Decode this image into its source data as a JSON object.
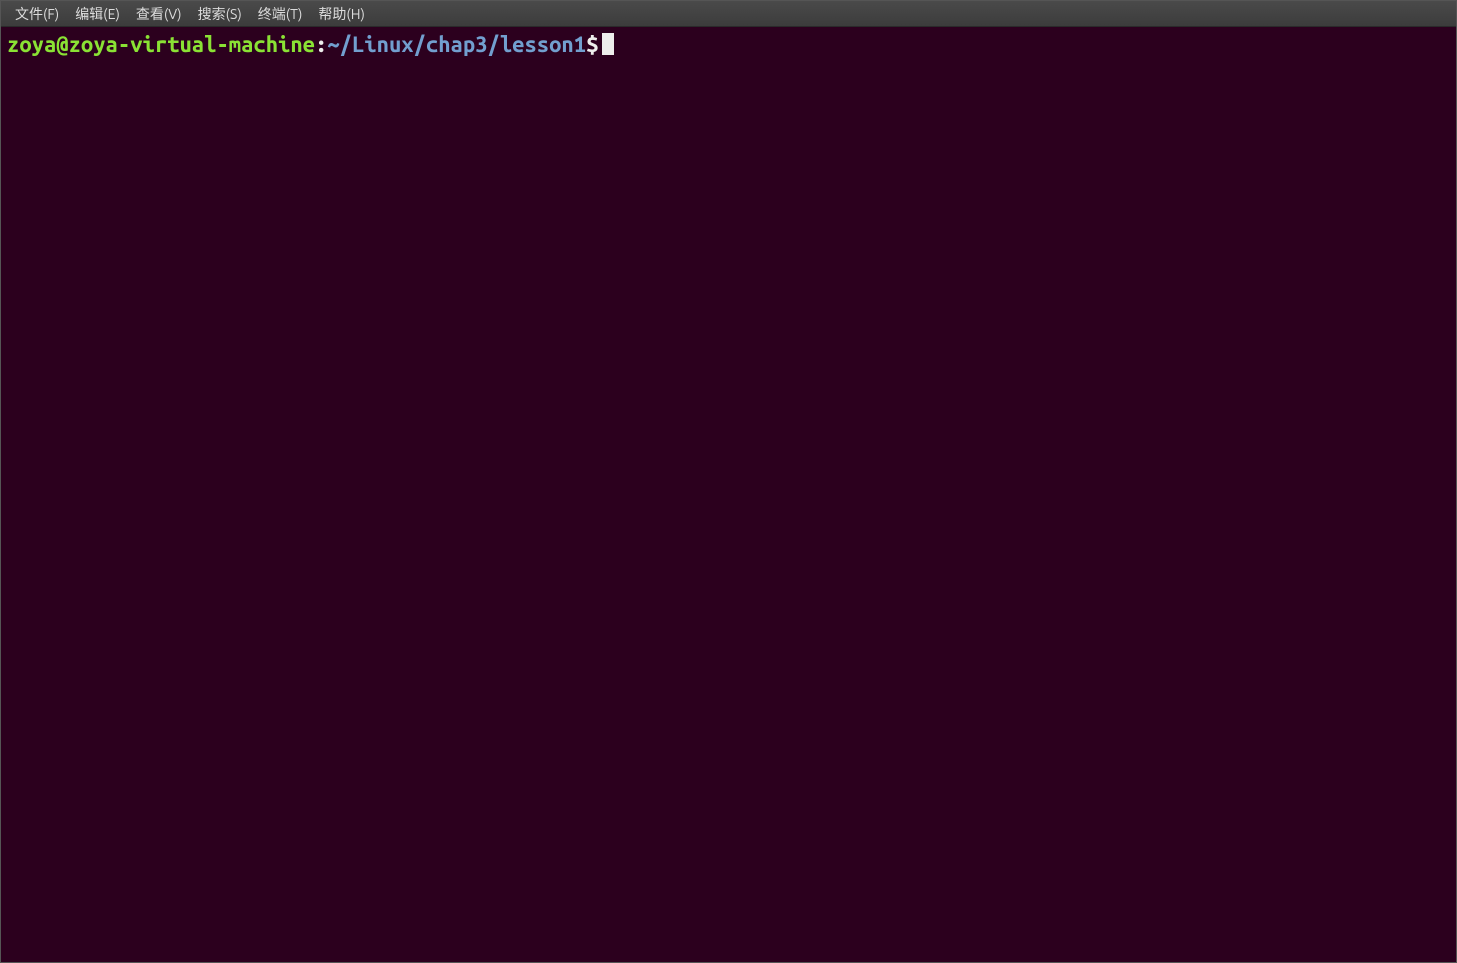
{
  "menubar": {
    "items": [
      "文件(F)",
      "编辑(E)",
      "查看(V)",
      "搜索(S)",
      "终端(T)",
      "帮助(H)"
    ]
  },
  "prompt": {
    "user_host": "zoya@zoya-virtual-machine",
    "separator": ":",
    "path": "~/Linux/chap3/lesson1",
    "symbol": "$"
  },
  "colors": {
    "background": "#2c001e",
    "menubar_bg": "#3c3c3c",
    "user_host": "#8ae234",
    "path": "#729fcf",
    "text": "#eeeeec"
  }
}
